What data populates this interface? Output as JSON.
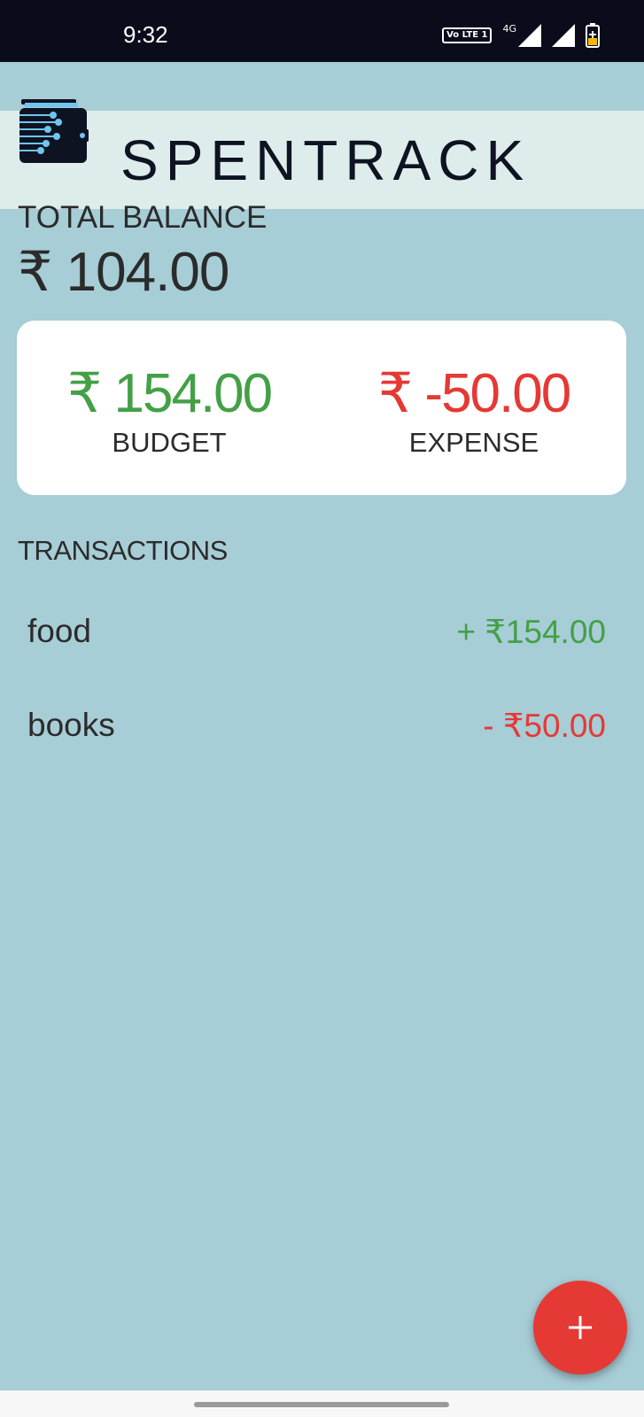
{
  "status_bar": {
    "time": "9:32",
    "volte": "Vo LTE 1",
    "network": "4G",
    "icons": [
      "signal-icon",
      "signal-icon",
      "battery-charging-icon"
    ]
  },
  "app": {
    "title": "SPENTRACK",
    "logo_icon": "wallet-circuit-icon"
  },
  "balance": {
    "label": "TOTAL BALANCE",
    "value": "₹ 104.00"
  },
  "summary": {
    "budget_amount": "₹ 154.00",
    "budget_label": "BUDGET",
    "expense_amount": "₹ -50.00",
    "expense_label": "EXPENSE"
  },
  "transactions": {
    "heading": "TRANSACTIONS",
    "items": [
      {
        "name": "food",
        "amount": "+ ₹154.00",
        "type": "income"
      },
      {
        "name": "books",
        "amount": "- ₹50.00",
        "type": "expense"
      }
    ]
  },
  "fab": {
    "icon": "plus-icon"
  },
  "colors": {
    "background": "#a7cdd6",
    "header_band": "#deedeb",
    "income": "#43a047",
    "expense": "#e53935",
    "fab": "#e53935"
  }
}
